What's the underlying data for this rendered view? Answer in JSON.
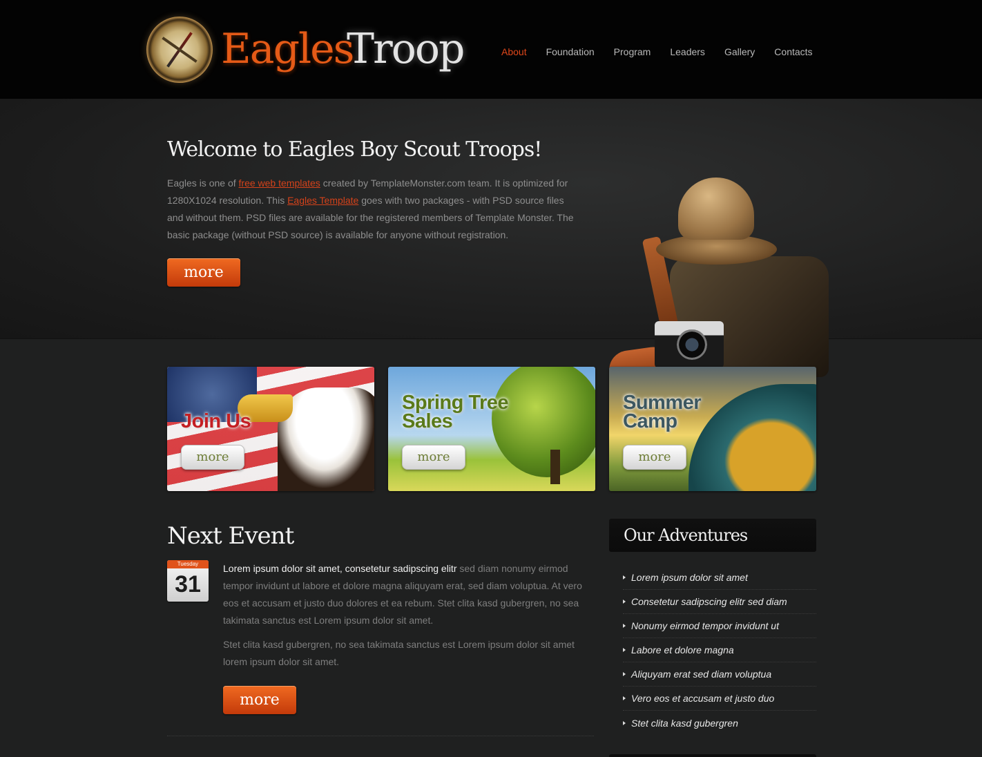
{
  "header": {
    "logo_word1": "Eagles",
    "logo_word2": "Troop",
    "nav": [
      {
        "label": "About",
        "active": true
      },
      {
        "label": "Foundation",
        "active": false
      },
      {
        "label": "Program",
        "active": false
      },
      {
        "label": "Leaders",
        "active": false
      },
      {
        "label": "Gallery",
        "active": false
      },
      {
        "label": "Contacts",
        "active": false
      }
    ]
  },
  "hero": {
    "title": "Welcome to Eagles Boy Scout Troops!",
    "text_1": "Eagles is one of ",
    "link_1": "free web templates",
    "text_2": " created by TemplateMonster.com team. It is optimized for 1280X1024 resolution. This ",
    "link_2": "Eagles Template",
    "text_3": " goes with two packages - with PSD source files and without them. PSD files are available for the registered members of Template Monster. The basic package (without PSD source) is available for anyone without registration.",
    "button": "more"
  },
  "promos": [
    {
      "title": "Join Us",
      "button": "more"
    },
    {
      "title": "Spring Tree Sales",
      "button": "more"
    },
    {
      "title": "Summer Camp",
      "button": "more"
    }
  ],
  "event": {
    "heading": "Next Event",
    "calendar_day": "Tuesday",
    "calendar_date": "31",
    "lead": "Lorem ipsum dolor sit amet, consetetur sadipscing elitr",
    "body_1": " sed diam nonumy eirmod tempor invidunt ut labore et dolore magna aliquyam erat, sed diam voluptua. At vero eos et accusam et justo duo dolores et ea rebum. Stet clita kasd gubergren, no sea takimata sanctus est Lorem ipsum dolor sit amet.",
    "body_2": "Stet clita kasd gubergren, no sea takimata sanctus est Lorem ipsum dolor sit amet lorem ipsum dolor sit amet.",
    "button": "more"
  },
  "adventures": {
    "heading": "Our Adventures",
    "items": [
      "Lorem ipsum dolor sit amet",
      "Consetetur sadipscing elitr sed diam",
      "Nonumy eirmod tempor invidunt ut",
      "Labore et dolore magna",
      "Aliquyam erat sed diam voluptua",
      "Vero eos et accusam et justo duo",
      "Stet clita kasd gubergren"
    ]
  },
  "colors": {
    "accent": "#e0471a",
    "button_orange": "#e55a17",
    "background": "#1f2020",
    "header": "#030303"
  }
}
